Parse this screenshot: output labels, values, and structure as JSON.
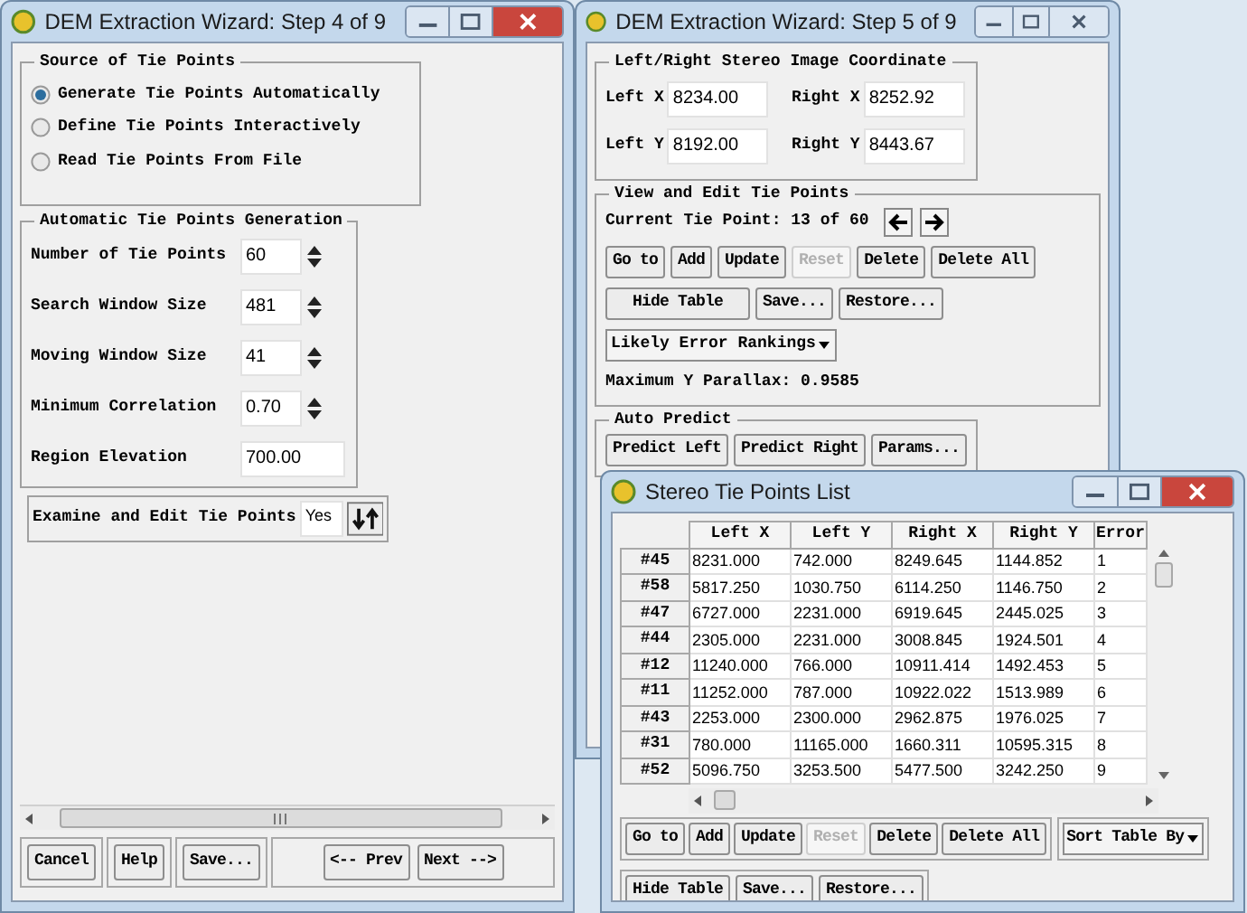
{
  "step4_window": {
    "title": "DEM Extraction Wizard: Step 4 of 9",
    "active": true,
    "source_group": {
      "title": "Source of Tie Points",
      "options": [
        {
          "label": "Generate Tie Points Automatically",
          "selected": true
        },
        {
          "label": "Define Tie Points Interactively",
          "selected": false
        },
        {
          "label": "Read Tie Points From File",
          "selected": false
        }
      ]
    },
    "auto_group": {
      "title": "Automatic Tie Points Generation",
      "fields": [
        {
          "label": "Number of Tie Points",
          "value": "60",
          "kind": "spinner"
        },
        {
          "label": "Search Window Size",
          "value": "481",
          "kind": "spinner"
        },
        {
          "label": "Moving Window Size",
          "value": "41",
          "kind": "spinner"
        },
        {
          "label": "Minimum Correlation",
          "value": "0.70",
          "kind": "spinner"
        },
        {
          "label": "Region Elevation",
          "value": "700.00",
          "kind": "text"
        }
      ]
    },
    "examine": {
      "label": "Examine and Edit Tie Points",
      "value": "Yes"
    },
    "buttons": [
      {
        "label": "Cancel"
      },
      {
        "label": "Help"
      },
      {
        "label": "Save..."
      },
      {
        "label": "<-- Prev"
      },
      {
        "label": "Next -->"
      }
    ]
  },
  "step5_window": {
    "title": "DEM Extraction Wizard: Step 5 of 9",
    "active": false,
    "coordinate_group": {
      "title": "Left/Right Stereo Image Coordinate",
      "fields": [
        {
          "label": "Left X",
          "value": "8234.00"
        },
        {
          "label": "Right X",
          "value": "8252.92"
        },
        {
          "label": "Left Y",
          "value": "8192.00"
        },
        {
          "label": "Right Y",
          "value": "8443.67"
        }
      ]
    },
    "edit_group": {
      "title": "View and Edit Tie Points",
      "current": "Current Tie Point: 13 of 60",
      "buttons": [
        {
          "label": "Go to",
          "disabled": false
        },
        {
          "label": "Add",
          "disabled": false
        },
        {
          "label": "Update",
          "disabled": false
        },
        {
          "label": "Reset",
          "disabled": true
        },
        {
          "label": "Delete",
          "disabled": false
        },
        {
          "label": "Delete All",
          "disabled": false
        }
      ],
      "table_buttons": [
        {
          "label": "Hide Table"
        },
        {
          "label": "Save..."
        },
        {
          "label": "Restore..."
        }
      ],
      "dropdown": "Likely Error Rankings",
      "parallax": "Maximum Y Parallax: 0.9585"
    },
    "auto_predict": {
      "title": "Auto Predict",
      "buttons": [
        {
          "label": "Predict Left"
        },
        {
          "label": "Predict Right"
        },
        {
          "label": "Params..."
        }
      ]
    }
  },
  "list_window": {
    "title": "Stereo Tie Points List",
    "active": true,
    "table": {
      "columns": [
        "Left X",
        "Left Y",
        "Right X",
        "Right Y",
        "Error"
      ],
      "rows": [
        {
          "header": "#45",
          "cells": [
            "8231.000",
            "742.000",
            "8249.645",
            "1144.852",
            "1"
          ]
        },
        {
          "header": "#58",
          "cells": [
            "5817.250",
            "1030.750",
            "6114.250",
            "1146.750",
            "2"
          ]
        },
        {
          "header": "#47",
          "cells": [
            "6727.000",
            "2231.000",
            "6919.645",
            "2445.025",
            "3"
          ]
        },
        {
          "header": "#44",
          "cells": [
            "2305.000",
            "2231.000",
            "3008.845",
            "1924.501",
            "4"
          ]
        },
        {
          "header": "#12",
          "cells": [
            "11240.000",
            "766.000",
            "10911.414",
            "1492.453",
            "5"
          ]
        },
        {
          "header": "#11",
          "cells": [
            "11252.000",
            "787.000",
            "10922.022",
            "1513.989",
            "6"
          ]
        },
        {
          "header": "#43",
          "cells": [
            "2253.000",
            "2300.000",
            "2962.875",
            "1976.025",
            "7"
          ]
        },
        {
          "header": "#31",
          "cells": [
            "780.000",
            "11165.000",
            "1660.311",
            "10595.315",
            "8"
          ]
        },
        {
          "header": "#52",
          "cells": [
            "5096.750",
            "3253.500",
            "5477.500",
            "3242.250",
            "9"
          ]
        }
      ]
    },
    "buttons": [
      {
        "label": "Go to",
        "disabled": false
      },
      {
        "label": "Add",
        "disabled": false
      },
      {
        "label": "Update",
        "disabled": false
      },
      {
        "label": "Reset",
        "disabled": true
      },
      {
        "label": "Delete",
        "disabled": false
      },
      {
        "label": "Delete All",
        "disabled": false
      }
    ],
    "sort_dropdown": "Sort Table By",
    "table_buttons": [
      {
        "label": "Hide Table"
      },
      {
        "label": "Save..."
      },
      {
        "label": "Restore..."
      }
    ]
  }
}
